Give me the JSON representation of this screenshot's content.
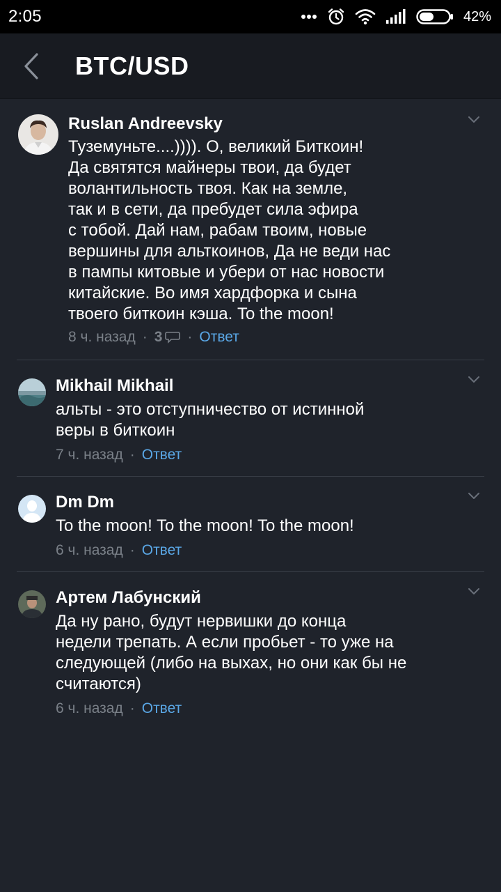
{
  "status_bar": {
    "time": "2:05",
    "battery_percent": "42%",
    "icons": [
      "more-dots-icon",
      "alarm-icon",
      "wifi-icon",
      "signal-icon",
      "battery-icon"
    ]
  },
  "app_bar": {
    "title": "BTC/USD",
    "back_icon": "chevron-left-icon"
  },
  "comments": [
    {
      "author": "Ruslan Andreevsky",
      "text": "Туземуньте....)))). О, великий Биткоин!\nДа святятся майнеры твои, да будет\nволантильность твоя. Как на земле,\nтак и в сети, да пребудет сила эфира\nс тобой. Дай нам, рабам твоим, новые\nвершины для альткоинов, Да не веди нас\nв пампы китовые и убери от нас новости\nкитайские. Во имя хардфорка и сына\nтвоего биткоин кэша. To the moon!",
      "time": "8 ч. назад",
      "replies_count": "3",
      "reply_label": "Ответ"
    },
    {
      "author": "Mikhail Mikhail",
      "text": "альты - это отступничество от истинной\nверы в биткоин",
      "time": "7 ч. назад",
      "reply_label": "Ответ"
    },
    {
      "author": "Dm Dm",
      "text": "To the moon!  To the moon!  To the moon!",
      "time": "6 ч. назад",
      "reply_label": "Ответ"
    },
    {
      "author": "Артем Лабунский",
      "text": "Да ну рано, будут нервишки до конца\nнедели трепать. А если пробьет - то уже на\nследующей (либо на выхах, но они как бы не\nсчитаются)",
      "time": "6 ч. назад",
      "reply_label": "Ответ"
    }
  ],
  "colors": {
    "background": "#1f232b",
    "app_bar": "#181b21",
    "accent_link": "#5aa7e6",
    "muted_text": "#7a8088"
  }
}
